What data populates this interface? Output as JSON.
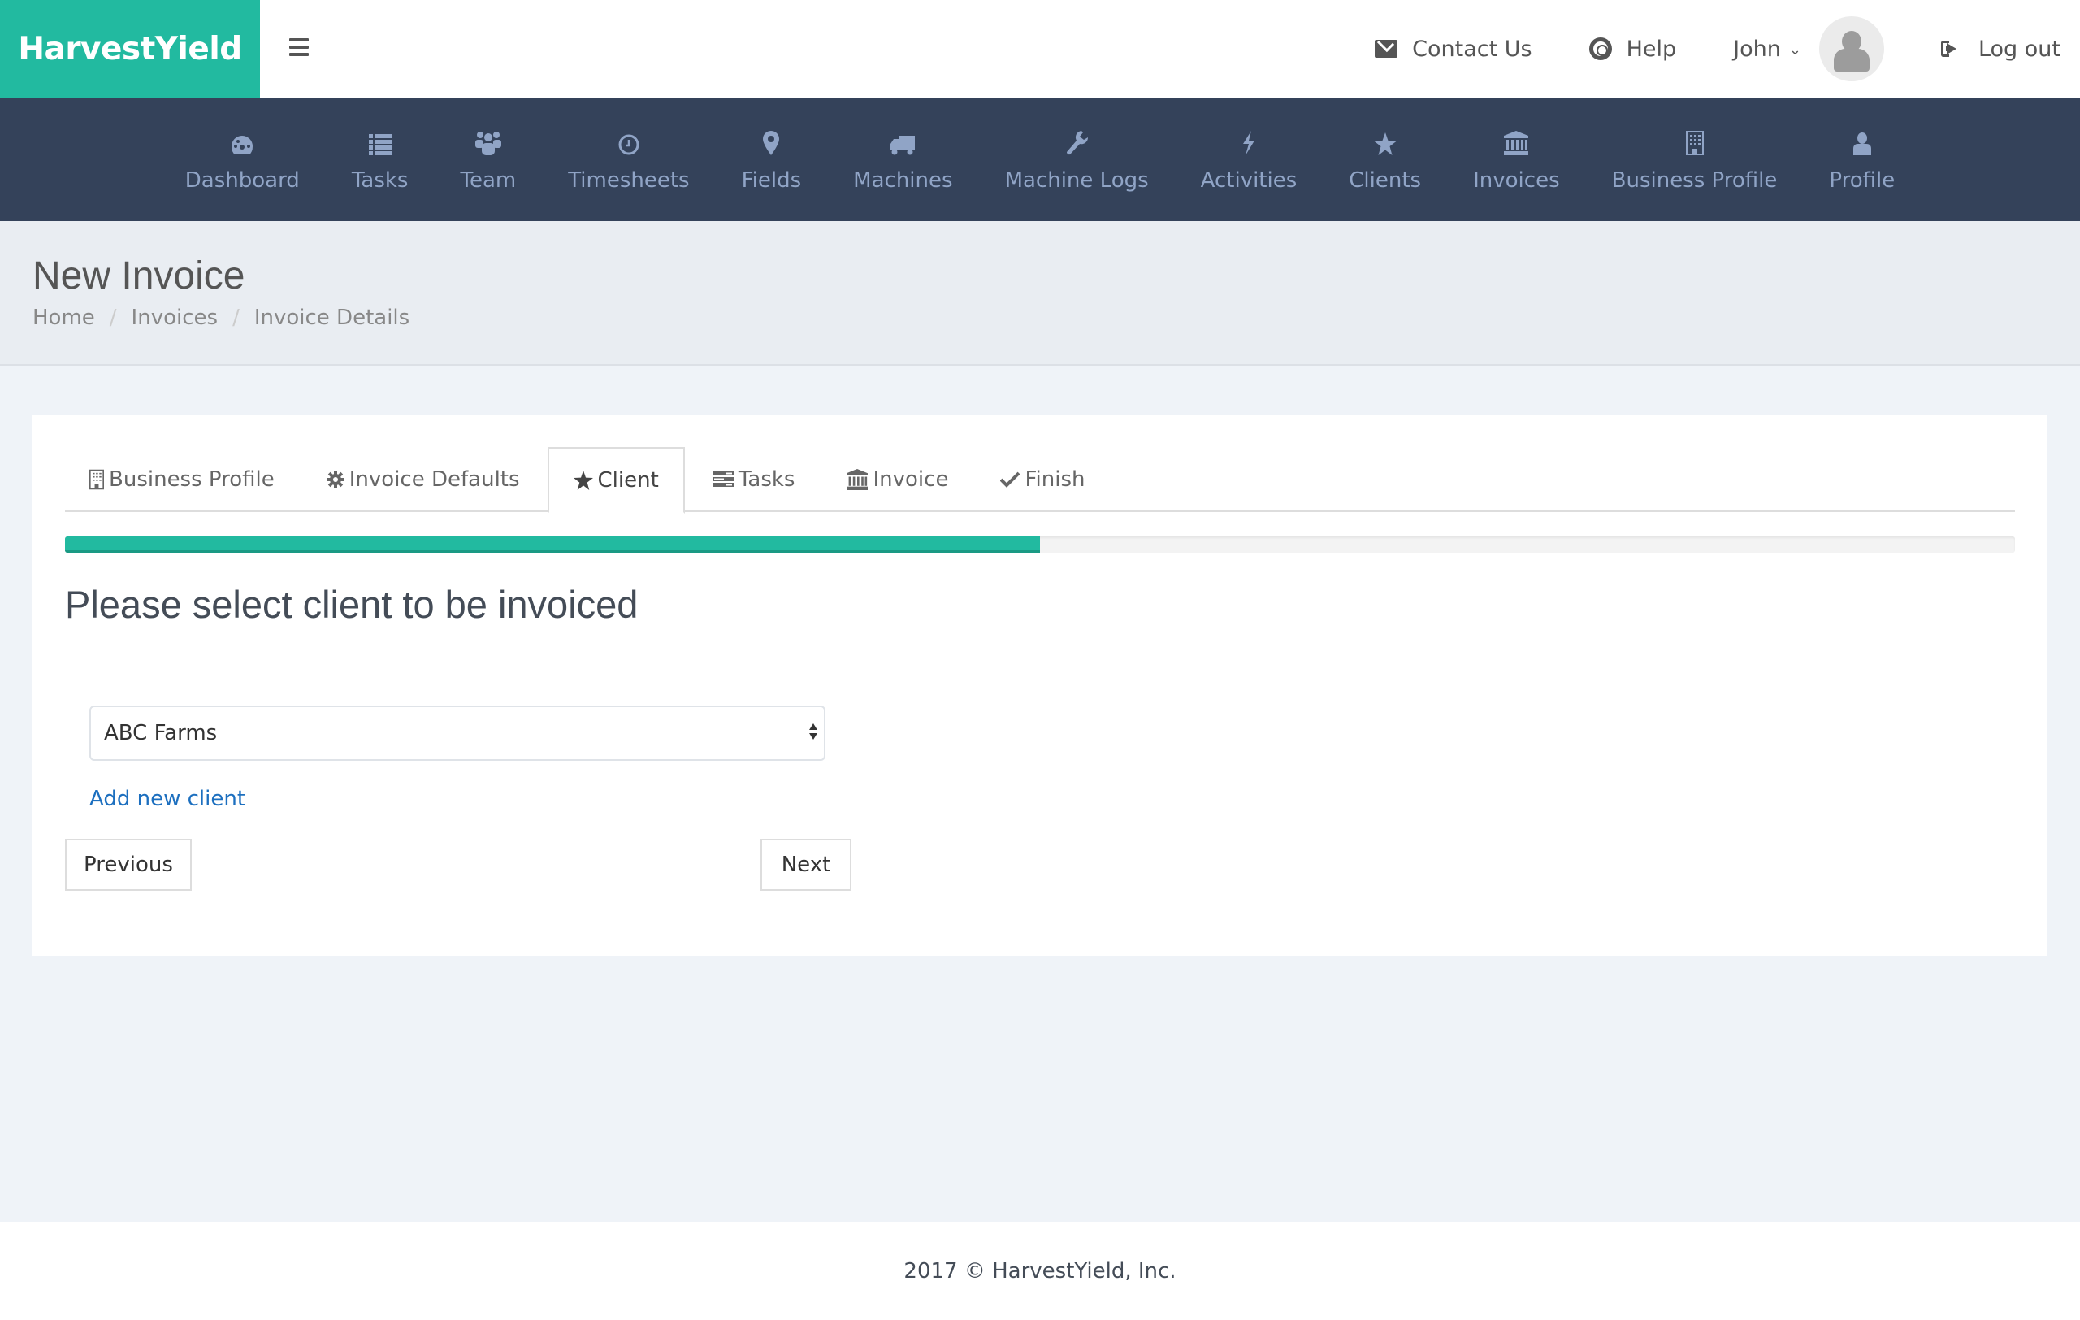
{
  "brand": {
    "name": "HarvestYield",
    "color": "#22baa0"
  },
  "topbar": {
    "menu_icon": "hamburger-icon",
    "contact": {
      "label": "Contact Us",
      "icon": "envelope-icon"
    },
    "help": {
      "label": "Help",
      "icon": "lifebuoy-icon"
    },
    "user": {
      "name": "John",
      "icon": "chevron-down-icon"
    },
    "logout": {
      "label": "Log out",
      "icon": "sign-out-icon"
    }
  },
  "nav": {
    "background": "#34425a",
    "items": [
      {
        "label": "Dashboard",
        "icon": "dashboard-icon"
      },
      {
        "label": "Tasks",
        "icon": "list-icon"
      },
      {
        "label": "Team",
        "icon": "users-icon"
      },
      {
        "label": "Timesheets",
        "icon": "clock-icon"
      },
      {
        "label": "Fields",
        "icon": "map-marker-icon"
      },
      {
        "label": "Machines",
        "icon": "truck-icon"
      },
      {
        "label": "Machine Logs",
        "icon": "wrench-icon"
      },
      {
        "label": "Activities",
        "icon": "bolt-icon"
      },
      {
        "label": "Clients",
        "icon": "star-icon"
      },
      {
        "label": "Invoices",
        "icon": "bank-icon"
      },
      {
        "label": "Business Profile",
        "icon": "building-icon"
      },
      {
        "label": "Profile",
        "icon": "user-icon"
      }
    ]
  },
  "page": {
    "title": "New Invoice",
    "breadcrumb": [
      "Home",
      "Invoices",
      "Invoice Details"
    ]
  },
  "wizard": {
    "tabs": [
      {
        "label": "Business Profile",
        "icon": "building-icon",
        "active": false
      },
      {
        "label": "Invoice Defaults",
        "icon": "gear-icon",
        "active": false
      },
      {
        "label": "Client",
        "icon": "star-icon",
        "active": true
      },
      {
        "label": "Tasks",
        "icon": "tasks-icon",
        "active": false
      },
      {
        "label": "Invoice",
        "icon": "bank-icon",
        "active": false
      },
      {
        "label": "Finish",
        "icon": "check-icon",
        "active": false
      }
    ],
    "progress_percent": 50,
    "section_title": "Please select client to be invoiced",
    "client_select": {
      "value": "ABC Farms"
    },
    "add_client_label": "Add new client",
    "previous_label": "Previous",
    "next_label": "Next"
  },
  "footer": {
    "text": "2017 © HarvestYield, Inc."
  }
}
